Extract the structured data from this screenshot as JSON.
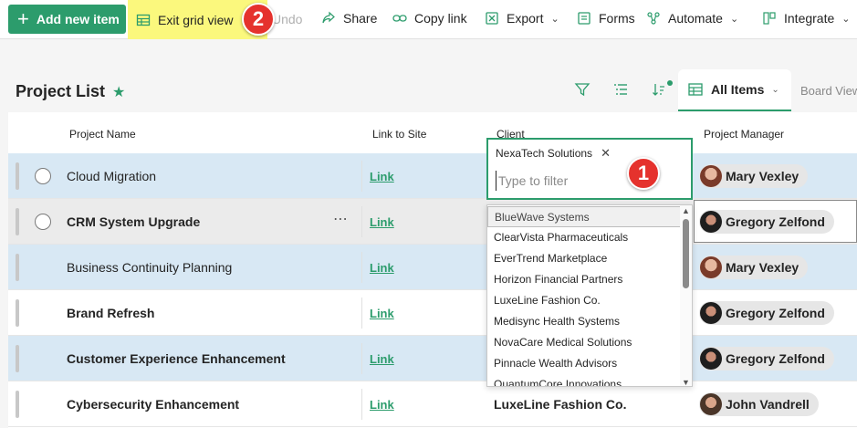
{
  "toolbar": {
    "add_new_item": "Add new item",
    "exit_grid_view": "Exit grid view",
    "undo": "Undo",
    "share": "Share",
    "copy_link": "Copy link",
    "export": "Export",
    "forms": "Forms",
    "automate": "Automate",
    "integrate": "Integrate"
  },
  "badges": {
    "filter_step": "1",
    "exit_step": "2"
  },
  "header": {
    "title": "Project List",
    "view_selector": "All Items",
    "board_view": "Board View"
  },
  "columns": {
    "project_name": "Project Name",
    "link_to_site": "Link to Site",
    "client": "Client",
    "project_manager": "Project Manager"
  },
  "rows": [
    {
      "name": "Cloud Migration",
      "link": "Link",
      "client": "",
      "manager": "Mary Vexley"
    },
    {
      "name": "CRM System Upgrade",
      "link": "Link",
      "client": "",
      "manager": "Gregory Zelfond"
    },
    {
      "name": "Business Continuity Planning",
      "link": "Link",
      "client": "",
      "manager": "Mary Vexley"
    },
    {
      "name": "Brand Refresh",
      "link": "Link",
      "client": "",
      "manager": "Gregory Zelfond"
    },
    {
      "name": "Customer Experience Enhancement",
      "link": "Link",
      "client": "",
      "manager": "Gregory Zelfond"
    },
    {
      "name": "Cybersecurity Enhancement",
      "link": "Link",
      "client": "LuxeLine Fashion Co.",
      "manager": "John Vandrell"
    }
  ],
  "filter": {
    "selected_chip": "NexaTech Solutions",
    "placeholder": "Type to filter",
    "options": [
      "BlueWave Systems",
      "ClearVista Pharmaceuticals",
      "EverTrend Marketplace",
      "Horizon Financial Partners",
      "LuxeLine Fashion Co.",
      "Medisync Health Systems",
      "NovaCare Medical Solutions",
      "Pinnacle Wealth Advisors",
      "QuantumCore Innovations"
    ]
  },
  "colors": {
    "accent": "#2c9c6c",
    "highlight": "#fbf87d",
    "badge": "#e5322d",
    "selected_row": "#d8e8f4"
  }
}
